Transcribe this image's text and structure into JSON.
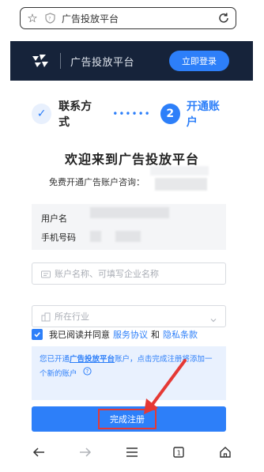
{
  "browser": {
    "url": "广告投放平台",
    "icons": [
      "star-icon",
      "shield-icon",
      "reload-icon"
    ]
  },
  "header": {
    "title": "广告投放平台",
    "login_label": "立即登录"
  },
  "steps": {
    "step1_label": "联系方式",
    "step2_number": "2",
    "step2_label": "开通账户",
    "dots": "••••••"
  },
  "main": {
    "welcome": "欢迎来到广告投放平台",
    "consult_label": "免费开通广告账户咨询：",
    "username_label": "用户名",
    "phone_label": "手机号码"
  },
  "form": {
    "account_name_placeholder": "账户名称、可填写企业名称",
    "industry_placeholder": "所在行业"
  },
  "agreement": {
    "prefix": "我已阅读并同意",
    "service": "服务协议",
    "and": "和",
    "privacy": "隐私条款"
  },
  "notice": {
    "part1": "您已开通",
    "link": "广告投放平台",
    "part2": "账户，点击完成注册将添加一个新的账户"
  },
  "submit_label": "完成注册",
  "colors": {
    "accent": "#2d7ff9",
    "header_bg": "#16233a",
    "highlight": "#e53935"
  }
}
